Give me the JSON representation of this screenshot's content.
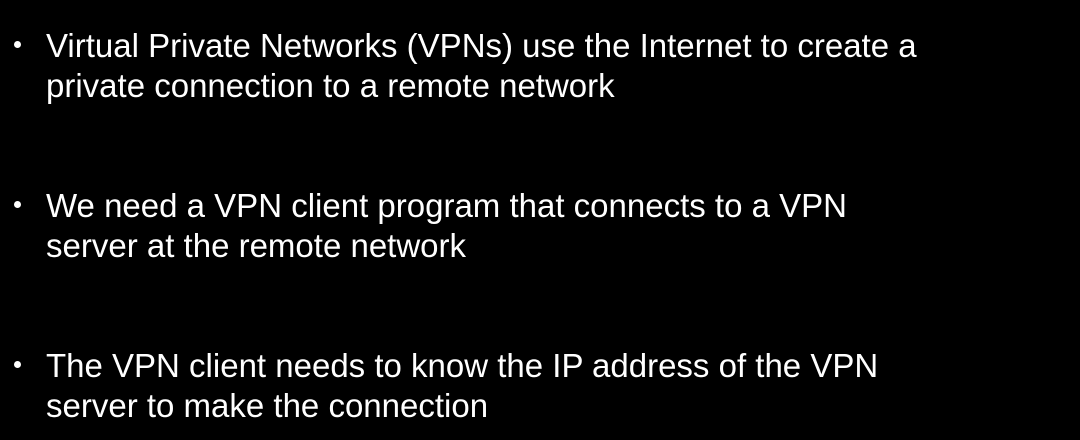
{
  "slide": {
    "bullets": [
      {
        "line1": "Virtual Private Networks (VPNs) use the Internet to create a",
        "line2": "private connection to a remote network"
      },
      {
        "line1": "We need a VPN client program that connects to a VPN",
        "line2": "server at the remote network"
      },
      {
        "line1": "The VPN client needs to know the IP address of the VPN",
        "line2": "server to make the connection"
      }
    ],
    "colors": {
      "background": "#000000",
      "text": "#ffffff"
    }
  }
}
